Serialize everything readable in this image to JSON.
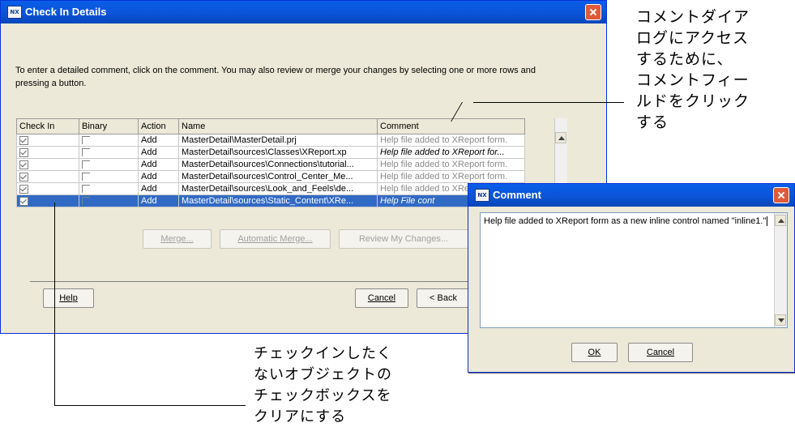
{
  "main_dialog": {
    "title": "Check In Details",
    "icon_text": "NX",
    "intro": "To enter a detailed comment, click on the comment. You may also review or merge your changes by selecting one or more rows and pressing a button.",
    "columns": [
      "Check In",
      "Binary",
      "Action",
      "Name",
      "Comment"
    ],
    "rows": [
      {
        "checked": true,
        "binary": false,
        "action": "Add",
        "name": "MasterDetail\\MasterDetail.prj",
        "comment": "Help file added to XReport form.",
        "comment_italic": false,
        "selected": false
      },
      {
        "checked": true,
        "binary": false,
        "action": "Add",
        "name": "MasterDetail\\sources\\Classes\\XReport.xp",
        "comment": "Help file added to XReport for...",
        "comment_italic": true,
        "selected": false
      },
      {
        "checked": true,
        "binary": false,
        "action": "Add",
        "name": "MasterDetail\\sources\\Connections\\tutorial...",
        "comment": "Help file added to XReport form.",
        "comment_italic": false,
        "selected": false
      },
      {
        "checked": true,
        "binary": false,
        "action": "Add",
        "name": "MasterDetail\\sources\\Control_Center_Me...",
        "comment": "Help file added to XReport form.",
        "comment_italic": false,
        "selected": false
      },
      {
        "checked": true,
        "binary": false,
        "action": "Add",
        "name": "MasterDetail\\sources\\Look_and_Feels\\de...",
        "comment": "Help file added to XReport form.",
        "comment_italic": false,
        "selected": false
      },
      {
        "checked": true,
        "binary": false,
        "action": "Add",
        "name": "MasterDetail\\sources\\Static_Content\\XRe...",
        "comment": "Help File cont",
        "comment_italic": true,
        "selected": true
      }
    ],
    "merge_label": "Merge...",
    "automatic_merge_label": "Automatic Merge...",
    "review_label": "Review My Changes...",
    "help_label": "Help",
    "cancel_label": "Cancel",
    "back_label": "< Back"
  },
  "comment_dialog": {
    "title": "Comment",
    "icon_text": "NX",
    "text": "Help file added to XReport form as a new inline control named \"inline1.\"",
    "ok_label": "OK",
    "cancel_label": "Cancel"
  },
  "callouts": {
    "top_right": [
      "コメントダイア",
      "ログにアクセス",
      "するために、",
      "コメントフィー",
      "ルドをクリック",
      "する"
    ],
    "bottom": [
      "チェックインしたく",
      "ないオブジェクトの",
      "チェックボックスを",
      "クリアにする"
    ]
  }
}
